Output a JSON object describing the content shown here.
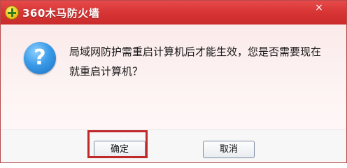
{
  "window": {
    "title": "360木马防火墙",
    "close_label": "×"
  },
  "dialog": {
    "icon": "question-icon",
    "icon_glyph": "?",
    "message": "局域网防护需重启计算机后才能生效，您是否需要现在就重启计算机？"
  },
  "buttons": {
    "ok_label": "确定",
    "cancel_label": "取消"
  },
  "colors": {
    "titlebar": "#d93636",
    "highlight_border": "#c0282a"
  }
}
